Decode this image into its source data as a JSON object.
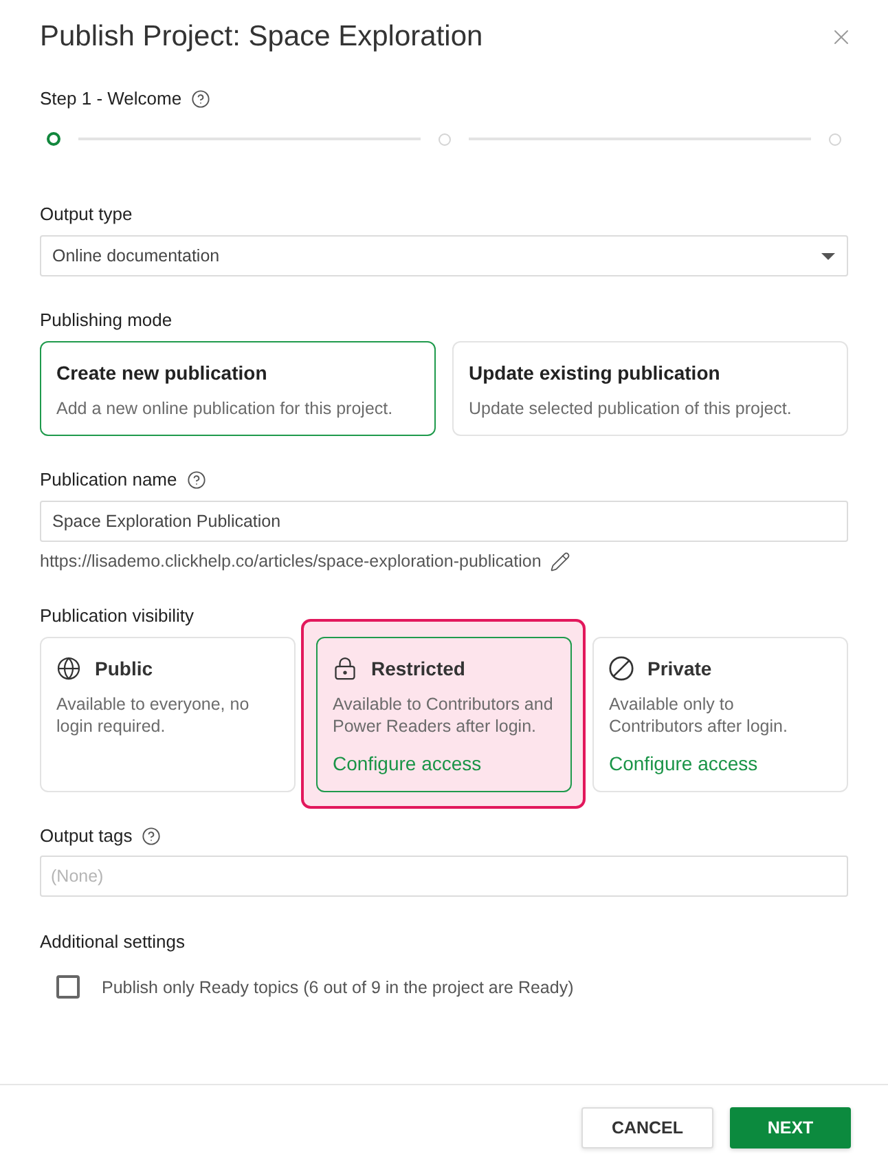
{
  "dialog": {
    "title": "Publish Project: Space Exploration"
  },
  "step": {
    "label": "Step 1 - Welcome",
    "steps": [
      {
        "active": true
      },
      {
        "active": false
      },
      {
        "active": false
      }
    ]
  },
  "output_type": {
    "label": "Output type",
    "value": "Online documentation"
  },
  "publishing_mode": {
    "label": "Publishing mode",
    "options": [
      {
        "title": "Create new publication",
        "description": "Add a new online publication for this project.",
        "selected": true
      },
      {
        "title": "Update existing publication",
        "description": "Update selected publication of this project.",
        "selected": false
      }
    ]
  },
  "publication_name": {
    "label": "Publication name",
    "value": "Space Exploration Publication",
    "url": "https://lisademo.clickhelp.co/articles/space-exploration-publication"
  },
  "visibility": {
    "label": "Publication visibility",
    "options": [
      {
        "title": "Public",
        "description": "Available to everyone, no login required.",
        "selected": false,
        "highlighted": false
      },
      {
        "title": "Restricted",
        "description": "Available to Contributors and Power Readers after login.",
        "link": "Configure access",
        "selected": true,
        "highlighted": true
      },
      {
        "title": "Private",
        "description": "Available only to Contributors after login.",
        "link": "Configure access",
        "selected": false,
        "highlighted": false
      }
    ]
  },
  "output_tags": {
    "label": "Output tags",
    "placeholder": "(None)"
  },
  "additional_settings": {
    "label": "Additional settings",
    "options": [
      {
        "label": "Publish only Ready topics (6 out of 9 in the project are Ready)",
        "checked": false
      }
    ]
  },
  "buttons": [
    {
      "label": "CANCEL",
      "kind": "secondary"
    },
    {
      "label": "NEXT",
      "kind": "primary"
    }
  ]
}
